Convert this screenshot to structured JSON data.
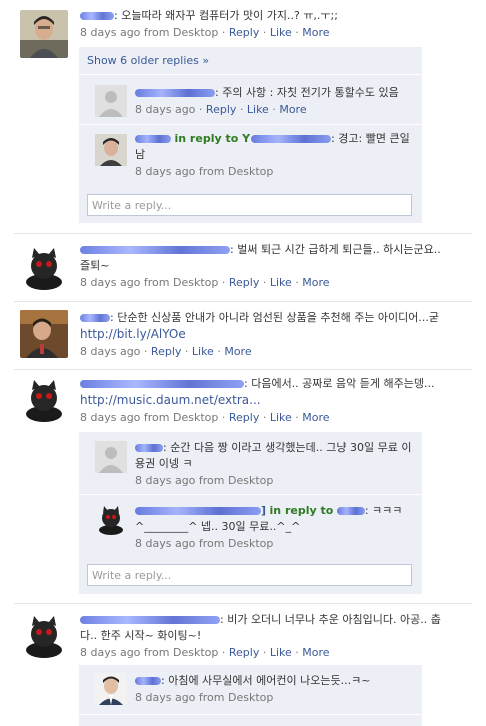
{
  "posts": [
    {
      "message": "오늘따라 왜자꾸 컴퓨터가 맛이 가지..? ㅠ,.ㅜ;;",
      "time": "8 days ago from Desktop",
      "actions": [
        "Reply",
        "Like",
        "More"
      ],
      "show_older": "Show 6 older replies »",
      "replies": [
        {
          "message": "주의 사항 : 자칫 전기가 통할수도 있음",
          "time": "8 days ago",
          "actions": [
            "Reply",
            "Like",
            "More"
          ]
        },
        {
          "in_reply_to": "in reply to Y",
          "message": "경고: 빨면 큰일남",
          "time": "8 days ago from Desktop"
        }
      ],
      "reply_placeholder": "Write a reply..."
    },
    {
      "message": "벌써 퇴근 시간 급하게 퇴근들.. 하시는군요.. 즐퇴~",
      "time": "8 days ago from Desktop",
      "actions": [
        "Reply",
        "Like",
        "More"
      ]
    },
    {
      "message": "단순한 신상품 안내가 아니라 엄선된 상품을 추천해 주는 아이디어...굳",
      "link": "http://bit.ly/AlYOe",
      "time": "8 days ago",
      "actions": [
        "Reply",
        "Like",
        "More"
      ]
    },
    {
      "message": "다음에서.. 공짜로 음악 듣게 해주는뎅...",
      "link": "http://music.daum.net/extra...",
      "time": "8 days ago from Desktop",
      "actions": [
        "Reply",
        "Like",
        "More"
      ],
      "replies": [
        {
          "message": "순간 다음 짱 이라고 생각했는데.. 그냥 30일 무료 이용권 이넹 ㅋ",
          "time": "8 days ago from Desktop"
        },
        {
          "author_suffix": "]",
          "in_reply_to": "in reply to",
          "message": "ㅋㅋㅋ ^________^ 넵.. 30일 무료..^_^",
          "time": "8 days ago from Desktop"
        }
      ],
      "reply_placeholder": "Write a reply..."
    },
    {
      "message": "비가 오더니 너무나 추운 아침입니다. 아공.. 춥다.. 한주 시작~ 화이팅~!",
      "time": "8 days ago from Desktop",
      "actions": [
        "Reply",
        "Like",
        "More"
      ],
      "replies": [
        {
          "message": "아침에 사무실에서 에어컨이 나오는듯...ㅋ~",
          "time": "8 days ago from Desktop"
        }
      ]
    }
  ],
  "colors": {
    "link": "#3b5998",
    "reply_bg": "#eceff5",
    "in_reply": "#2f7a23"
  }
}
